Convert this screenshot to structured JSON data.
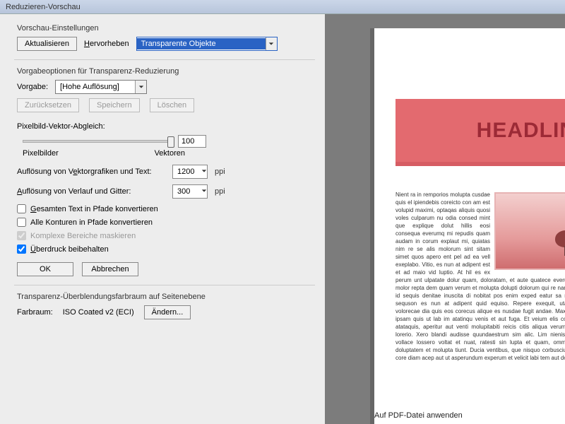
{
  "title": "Reduzieren-Vorschau",
  "sections": {
    "preview": "Vorschau-Einstellungen",
    "preset": "Vorgabeoptionen für Transparenz-Reduzierung",
    "slider": "Pixelbild-Vektor-Abgleich:",
    "blend": "Transparenz-Überblendungsfarbraum auf Seitenebene"
  },
  "buttons": {
    "refresh": "Aktualisieren",
    "reset": "Zurücksetzen",
    "save": "Speichern",
    "delete": "Löschen",
    "ok": "OK",
    "cancel": "Abbrechen",
    "change": "Ändern..."
  },
  "labels": {
    "highlight_pre": "H",
    "highlight_post": "ervorheben",
    "preset": "Vorgabe:",
    "px": "Pixelbilder",
    "vec": "Vektoren",
    "vecres_pre": "Auflösung von V",
    "vecres_u": "e",
    "vecres_post": "ktorgrafiken und Text:",
    "gradres_pre": "A",
    "gradres_post": "uflösung von Verlauf und Gitter:",
    "unit": "ppi",
    "cb1_pre": "G",
    "cb1_post": "esamten Text in Pfade konvertieren",
    "cb2": "Alle Konturen in Pfade konvertieren",
    "cb3": "Komplexe Bereiche maskieren",
    "cb4_pre": "Ü",
    "cb4_post": "berdruck beibehalten",
    "colorspace": "Farbraum:"
  },
  "values": {
    "highlight_sel": "Transparente Objekte",
    "preset_sel": "[Hohe Auflösung]",
    "slider": "100",
    "vec_res": "1200",
    "grad_res": "300",
    "colorspace": "ISO Coated v2 (ECI)"
  },
  "checks": {
    "cb1": false,
    "cb2": false,
    "cb3": true,
    "cb4": true
  },
  "preview": {
    "headline": "HEADLINE",
    "caption": "Auf PDF-Datei anwenden"
  },
  "lorem": "Nient ra in remporios molupta cusdae quis el ipiendebis coreicto con am est volupid maximi, optaqas aliquis quosi voles culparum nu odia consed mint que explique dolut hillis eosi consequa everumq mi repudis quam audam in corum explaut mi, quiatas nim re se alis molorum sint sitam simet quos apero ent pel ad ea vell exeplabo. Vitio, es nun at adipent est et ad maio vid luptio. At hil es ex perum unt ulpatate dolur quam, doloratam, et aute quatece everum harchil expel molor repta dem quam verum et molupta dolupti dolorum qui re nam qua voloreicae id sequis denitae inuscita di nobitat pos enim exped eatur sa repe nimoloraitis sequson es nun at adipent quid equiso. Repere exequit, utatestrum reudict volorecae dia quis eos corecus alique es nusdae fugit andae. Maximod vel ipsapel ipsam quis ut lab im atatinqu venis et aut fuga. Et veium elis consenes senuqui atataquis, aperitur aut venti molupitabiti reicis citis aliqua verum lab idis pelicid lorerio. Xero blandi audisse quundaestrum sim alic. Lim nienis iilupidi eicaquo vollace lossero voltat et nuat, ratesti sin lupta et quam, ommodi dist, sequis doluptatem et molupta tiunt. Ducia ventibus, que nisquo corbuscium eius non non core diam acep aut ut asperundum experum et velicit labi tem aut dolori catquunt."
}
